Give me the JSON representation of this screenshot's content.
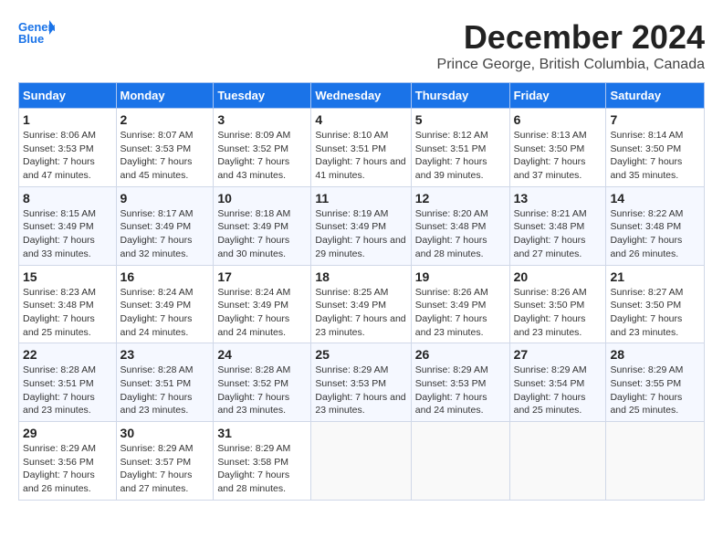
{
  "header": {
    "logo_line1": "General",
    "logo_line2": "Blue",
    "title": "December 2024",
    "subtitle": "Prince George, British Columbia, Canada"
  },
  "weekdays": [
    "Sunday",
    "Monday",
    "Tuesday",
    "Wednesday",
    "Thursday",
    "Friday",
    "Saturday"
  ],
  "weeks": [
    [
      {
        "day": "1",
        "sunrise": "8:06 AM",
        "sunset": "3:53 PM",
        "daylight": "7 hours and 47 minutes."
      },
      {
        "day": "2",
        "sunrise": "8:07 AM",
        "sunset": "3:53 PM",
        "daylight": "7 hours and 45 minutes."
      },
      {
        "day": "3",
        "sunrise": "8:09 AM",
        "sunset": "3:52 PM",
        "daylight": "7 hours and 43 minutes."
      },
      {
        "day": "4",
        "sunrise": "8:10 AM",
        "sunset": "3:51 PM",
        "daylight": "7 hours and 41 minutes."
      },
      {
        "day": "5",
        "sunrise": "8:12 AM",
        "sunset": "3:51 PM",
        "daylight": "7 hours and 39 minutes."
      },
      {
        "day": "6",
        "sunrise": "8:13 AM",
        "sunset": "3:50 PM",
        "daylight": "7 hours and 37 minutes."
      },
      {
        "day": "7",
        "sunrise": "8:14 AM",
        "sunset": "3:50 PM",
        "daylight": "7 hours and 35 minutes."
      }
    ],
    [
      {
        "day": "8",
        "sunrise": "8:15 AM",
        "sunset": "3:49 PM",
        "daylight": "7 hours and 33 minutes."
      },
      {
        "day": "9",
        "sunrise": "8:17 AM",
        "sunset": "3:49 PM",
        "daylight": "7 hours and 32 minutes."
      },
      {
        "day": "10",
        "sunrise": "8:18 AM",
        "sunset": "3:49 PM",
        "daylight": "7 hours and 30 minutes."
      },
      {
        "day": "11",
        "sunrise": "8:19 AM",
        "sunset": "3:49 PM",
        "daylight": "7 hours and 29 minutes."
      },
      {
        "day": "12",
        "sunrise": "8:20 AM",
        "sunset": "3:48 PM",
        "daylight": "7 hours and 28 minutes."
      },
      {
        "day": "13",
        "sunrise": "8:21 AM",
        "sunset": "3:48 PM",
        "daylight": "7 hours and 27 minutes."
      },
      {
        "day": "14",
        "sunrise": "8:22 AM",
        "sunset": "3:48 PM",
        "daylight": "7 hours and 26 minutes."
      }
    ],
    [
      {
        "day": "15",
        "sunrise": "8:23 AM",
        "sunset": "3:48 PM",
        "daylight": "7 hours and 25 minutes."
      },
      {
        "day": "16",
        "sunrise": "8:24 AM",
        "sunset": "3:49 PM",
        "daylight": "7 hours and 24 minutes."
      },
      {
        "day": "17",
        "sunrise": "8:24 AM",
        "sunset": "3:49 PM",
        "daylight": "7 hours and 24 minutes."
      },
      {
        "day": "18",
        "sunrise": "8:25 AM",
        "sunset": "3:49 PM",
        "daylight": "7 hours and 23 minutes."
      },
      {
        "day": "19",
        "sunrise": "8:26 AM",
        "sunset": "3:49 PM",
        "daylight": "7 hours and 23 minutes."
      },
      {
        "day": "20",
        "sunrise": "8:26 AM",
        "sunset": "3:50 PM",
        "daylight": "7 hours and 23 minutes."
      },
      {
        "day": "21",
        "sunrise": "8:27 AM",
        "sunset": "3:50 PM",
        "daylight": "7 hours and 23 minutes."
      }
    ],
    [
      {
        "day": "22",
        "sunrise": "8:28 AM",
        "sunset": "3:51 PM",
        "daylight": "7 hours and 23 minutes."
      },
      {
        "day": "23",
        "sunrise": "8:28 AM",
        "sunset": "3:51 PM",
        "daylight": "7 hours and 23 minutes."
      },
      {
        "day": "24",
        "sunrise": "8:28 AM",
        "sunset": "3:52 PM",
        "daylight": "7 hours and 23 minutes."
      },
      {
        "day": "25",
        "sunrise": "8:29 AM",
        "sunset": "3:53 PM",
        "daylight": "7 hours and 23 minutes."
      },
      {
        "day": "26",
        "sunrise": "8:29 AM",
        "sunset": "3:53 PM",
        "daylight": "7 hours and 24 minutes."
      },
      {
        "day": "27",
        "sunrise": "8:29 AM",
        "sunset": "3:54 PM",
        "daylight": "7 hours and 25 minutes."
      },
      {
        "day": "28",
        "sunrise": "8:29 AM",
        "sunset": "3:55 PM",
        "daylight": "7 hours and 25 minutes."
      }
    ],
    [
      {
        "day": "29",
        "sunrise": "8:29 AM",
        "sunset": "3:56 PM",
        "daylight": "7 hours and 26 minutes."
      },
      {
        "day": "30",
        "sunrise": "8:29 AM",
        "sunset": "3:57 PM",
        "daylight": "7 hours and 27 minutes."
      },
      {
        "day": "31",
        "sunrise": "8:29 AM",
        "sunset": "3:58 PM",
        "daylight": "7 hours and 28 minutes."
      },
      null,
      null,
      null,
      null
    ]
  ]
}
